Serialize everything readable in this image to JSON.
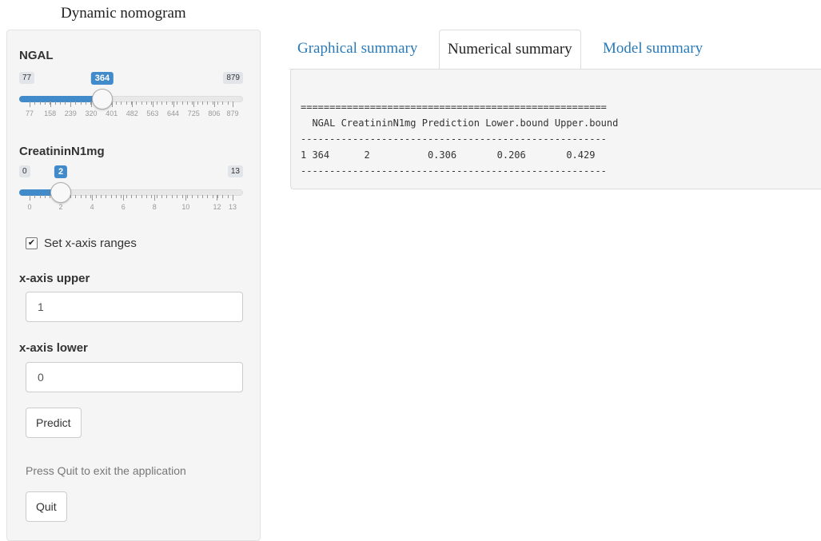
{
  "app": {
    "title": "Dynamic nomogram"
  },
  "sidebar": {
    "slider_ngal": {
      "label": "NGAL",
      "min": "77",
      "max": "879",
      "value": "364",
      "value_fraction": 0.358,
      "tick_labels": [
        "77",
        "158",
        "239",
        "320",
        "401",
        "482",
        "563",
        "644",
        "725",
        "806",
        "879"
      ]
    },
    "slider_creat": {
      "label": "CreatininN1mg",
      "min": "0",
      "max": "13",
      "value": "2",
      "value_fraction": 0.154,
      "tick_labels": [
        "0",
        "2",
        "4",
        "6",
        "8",
        "10",
        "12",
        "13"
      ]
    },
    "checkbox": {
      "label": "Set x-axis ranges",
      "checked": true
    },
    "x_upper": {
      "label": "x-axis upper",
      "value": "1"
    },
    "x_lower": {
      "label": "x-axis lower",
      "value": "0"
    },
    "predict_label": "Predict",
    "help_text": "Press Quit to exit the application",
    "quit_label": "Quit"
  },
  "tabs": [
    "Graphical summary",
    "Numerical summary",
    "Model summary"
  ],
  "active_tab": 1,
  "output": {
    "rule_top": "=====================================================",
    "header": "  NGAL CreatininN1mg Prediction Lower.bound Upper.bound",
    "rule_mid": "-----------------------------------------------------",
    "row": "1 364      2          0.306       0.206       0.429",
    "rule_bottom": "-----------------------------------------------------"
  },
  "colors": {
    "accent": "#428bca",
    "link": "#2a7ab8",
    "panel": "#f5f5f5"
  }
}
